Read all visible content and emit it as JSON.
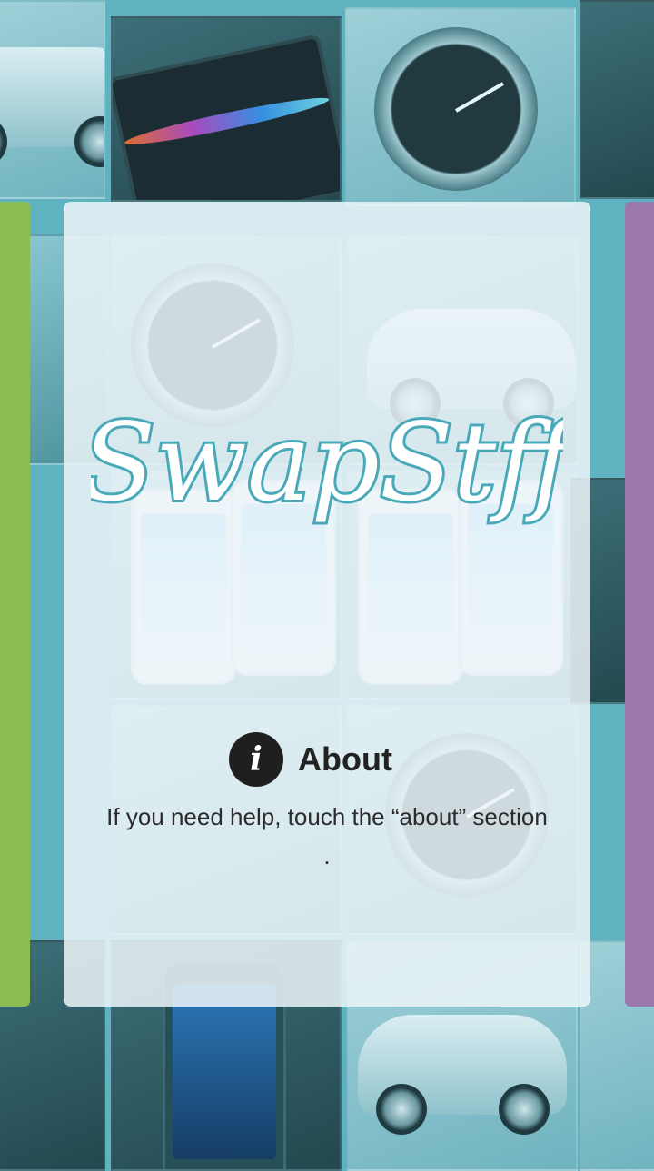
{
  "app": {
    "logo_text": "SwapStff"
  },
  "about": {
    "icon": "info-icon",
    "icon_glyph": "i",
    "label": "About",
    "help_text": "If you need help, touch the “about” section ."
  },
  "colors": {
    "background_tint": "#5fb3c0",
    "left_bar": "#8dbd52",
    "right_bar": "#9a78ad",
    "logo_fill": "#ffffff",
    "logo_stroke": "#4aa9b8",
    "info_icon_bg": "#1f1f1f"
  }
}
